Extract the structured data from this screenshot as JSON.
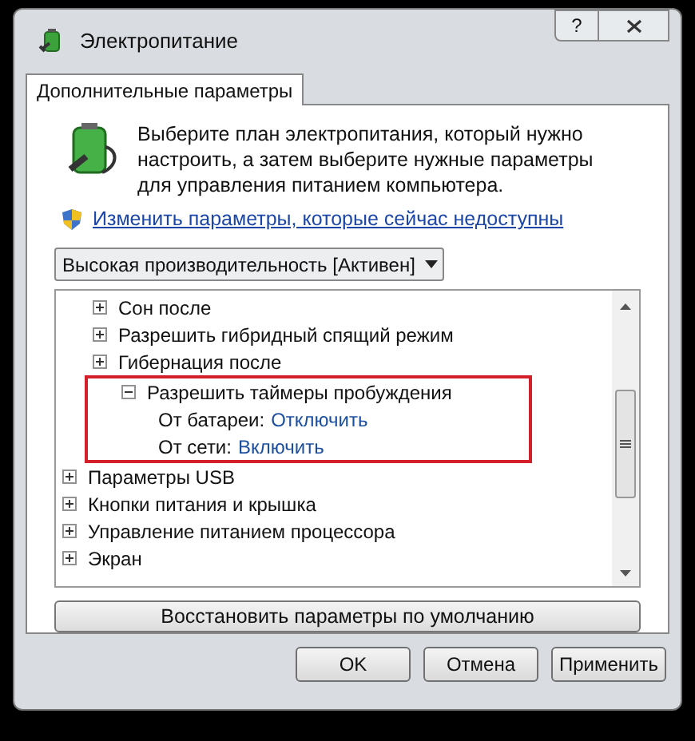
{
  "window": {
    "title": "Электропитание",
    "help_button": "?"
  },
  "tabs": [
    {
      "label": "Дополнительные параметры",
      "selected": true
    }
  ],
  "intro": "Выберите план электропитания, который нужно настроить, а затем выберите нужные параметры для управления питанием компьютера.",
  "admin_link": "Изменить параметры, которые сейчас недоступны",
  "plan_select": {
    "value": "Высокая производительность [Активен]"
  },
  "tree": {
    "items": [
      {
        "children": [
          {
            "label": "Сон после",
            "expanded": false,
            "highlighted": false
          },
          {
            "label": "Разрешить гибридный спящий режим",
            "expanded": false,
            "highlighted": false
          },
          {
            "label": "Гибернация после",
            "expanded": false,
            "highlighted": false
          },
          {
            "label": "Разрешить таймеры пробуждения",
            "expanded": true,
            "highlighted": true,
            "children": [
              {
                "label": "От батареи:",
                "value": "Отключить"
              },
              {
                "label": "От сети:",
                "value": "Включить"
              }
            ]
          }
        ]
      },
      {
        "label": "Параметры USB",
        "expanded": false,
        "highlighted": false
      },
      {
        "label": "Кнопки питания и крышка",
        "expanded": false,
        "highlighted": false
      },
      {
        "label": "Управление питанием процессора",
        "expanded": false,
        "highlighted": false
      },
      {
        "label": "Экран",
        "expanded": false,
        "highlighted": false
      }
    ]
  },
  "restore_button": "Восстановить параметры по умолчанию",
  "buttons": [
    "OK",
    "Отмена",
    "Применить"
  ]
}
